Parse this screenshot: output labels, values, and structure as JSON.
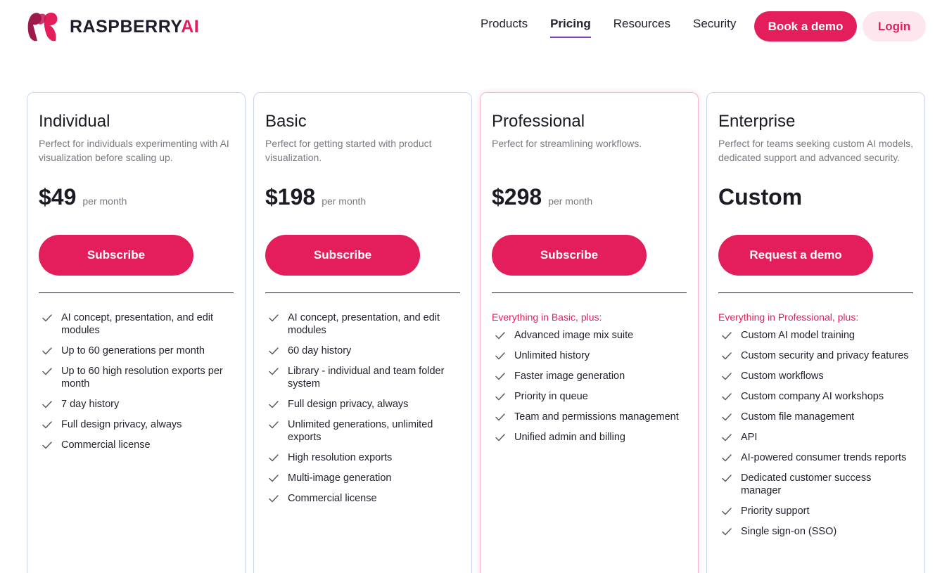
{
  "brand": {
    "name_main": "RASPBERRY",
    "name_accent": "AI",
    "accent_color": "#e41e5a"
  },
  "nav": {
    "items": [
      {
        "label": "Products"
      },
      {
        "label": "Pricing",
        "active": true
      },
      {
        "label": "Resources"
      },
      {
        "label": "Security"
      }
    ],
    "book_demo": "Book a demo",
    "login": "Login"
  },
  "plans": [
    {
      "name": "Individual",
      "description": "Perfect for individuals experimenting with AI visualization before scaling up.",
      "price": "$49",
      "period": "per month",
      "cta": "Subscribe",
      "features": [
        "AI concept, presentation, and edit modules",
        "Up to 60 generations per month",
        "Up to 60 high resolution exports per month",
        "7 day history",
        "Full design privacy, always",
        "Commercial license"
      ]
    },
    {
      "name": "Basic",
      "description": "Perfect for getting started with product visualization.",
      "price": "$198",
      "period": "per month",
      "cta": "Subscribe",
      "features": [
        "AI concept, presentation, and edit modules",
        "60 day history",
        "Library - individual and team folder system",
        "Full design privacy, always",
        "Unlimited generations, unlimited exports",
        "High resolution exports",
        "Multi-image generation",
        "Commercial license"
      ]
    },
    {
      "name": "Professional",
      "description": "Perfect for streamlining workflows.",
      "price": "$298",
      "period": "per month",
      "cta": "Subscribe",
      "includes": "Everything in Basic, plus:",
      "features": [
        "Advanced image mix suite",
        "Unlimited history",
        "Faster image generation",
        "Priority in queue",
        "Team and permissions management",
        "Unified admin and billing"
      ]
    },
    {
      "name": "Enterprise",
      "description": "Perfect for teams seeking custom AI models, dedicated support and advanced security.",
      "price": "Custom",
      "cta": "Request a demo",
      "includes": "Everything in Professional, plus:",
      "features": [
        "Custom AI model training",
        "Custom security and privacy features",
        "Custom workflows",
        "Custom company AI workshops",
        "Custom file management",
        "API",
        "AI-powered consumer trends reports",
        "Dedicated customer success manager",
        "Priority support",
        "Single sign-on (SSO)"
      ]
    }
  ]
}
